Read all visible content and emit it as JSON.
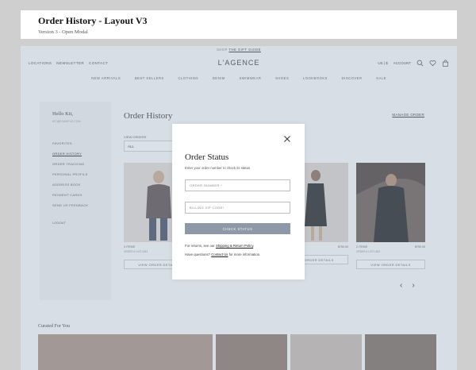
{
  "header": {
    "title": "Order History - Layout V3",
    "subtitle": "Version 3 - Open Modal"
  },
  "site": {
    "promo": {
      "text": "SHOP",
      "link": "THE GIFT GUIDE"
    },
    "topnav_left": [
      "LOCATIONS",
      "NEWSLETTER",
      "CONTACT"
    ],
    "logo": "L'AGENCE",
    "currency": "US | $",
    "account_label": "ACCOUNT",
    "icons": [
      "search-icon",
      "heart-icon",
      "bag-icon"
    ],
    "main_nav": [
      "NEW ARRIVALS",
      "BEST SELLERS",
      "CLOTHING",
      "DENIM",
      "SWIMWEAR",
      "SHOES",
      "LOOKBOOKS",
      "DISCOVER",
      "SALE"
    ]
  },
  "sidebar": {
    "greeting": "Hello Kit,",
    "email": "KIT@EXAMPLE.COM",
    "items": [
      "FAVORITES",
      "ORDER HISTORY",
      "ORDER TRACKING",
      "PERSONAL PROFILE",
      "ADDRESS BOOK",
      "PAYMENT CARDS",
      "SEND US FEEDBACK"
    ],
    "active": "ORDER HISTORY",
    "logout": "LOGOUT"
  },
  "order_history": {
    "title": "Order History",
    "manage_link": "MANAGE ORDER",
    "view_label": "VIEW ORDERS",
    "view_value": "ALL",
    "cards": [
      {
        "name": "3 ITEMS",
        "price": "",
        "date": "ORDER # 1473 1843",
        "button": "VIEW ORDER DETAILS"
      },
      {
        "name": "",
        "price": "$750.00",
        "date": "",
        "button": "VIEW ORDER DETAILS"
      },
      {
        "name": "2 ITEMS",
        "price": "$750.00",
        "date": "ORDER # 1473 1843",
        "button": "VIEW ORDER DETAILS"
      }
    ]
  },
  "curated": {
    "title": "Curated For You"
  },
  "modal": {
    "title": "Order Status",
    "description": "Enter your order number to check its status",
    "order_placeholder": "ORDER NUMBER *",
    "zip_placeholder": "BILLING ZIP CODE*",
    "button": "CHECK STATUS",
    "note1_prefix": "For returns, see our ",
    "note1_link": "Shipping & Return Policy",
    "note1_suffix": ".",
    "note2_prefix": "Have questions? ",
    "note2_link": "Contact Us",
    "note2_suffix": " for more information."
  },
  "colors": {
    "overlay": "#96a8be",
    "button": "#8d99a6"
  }
}
